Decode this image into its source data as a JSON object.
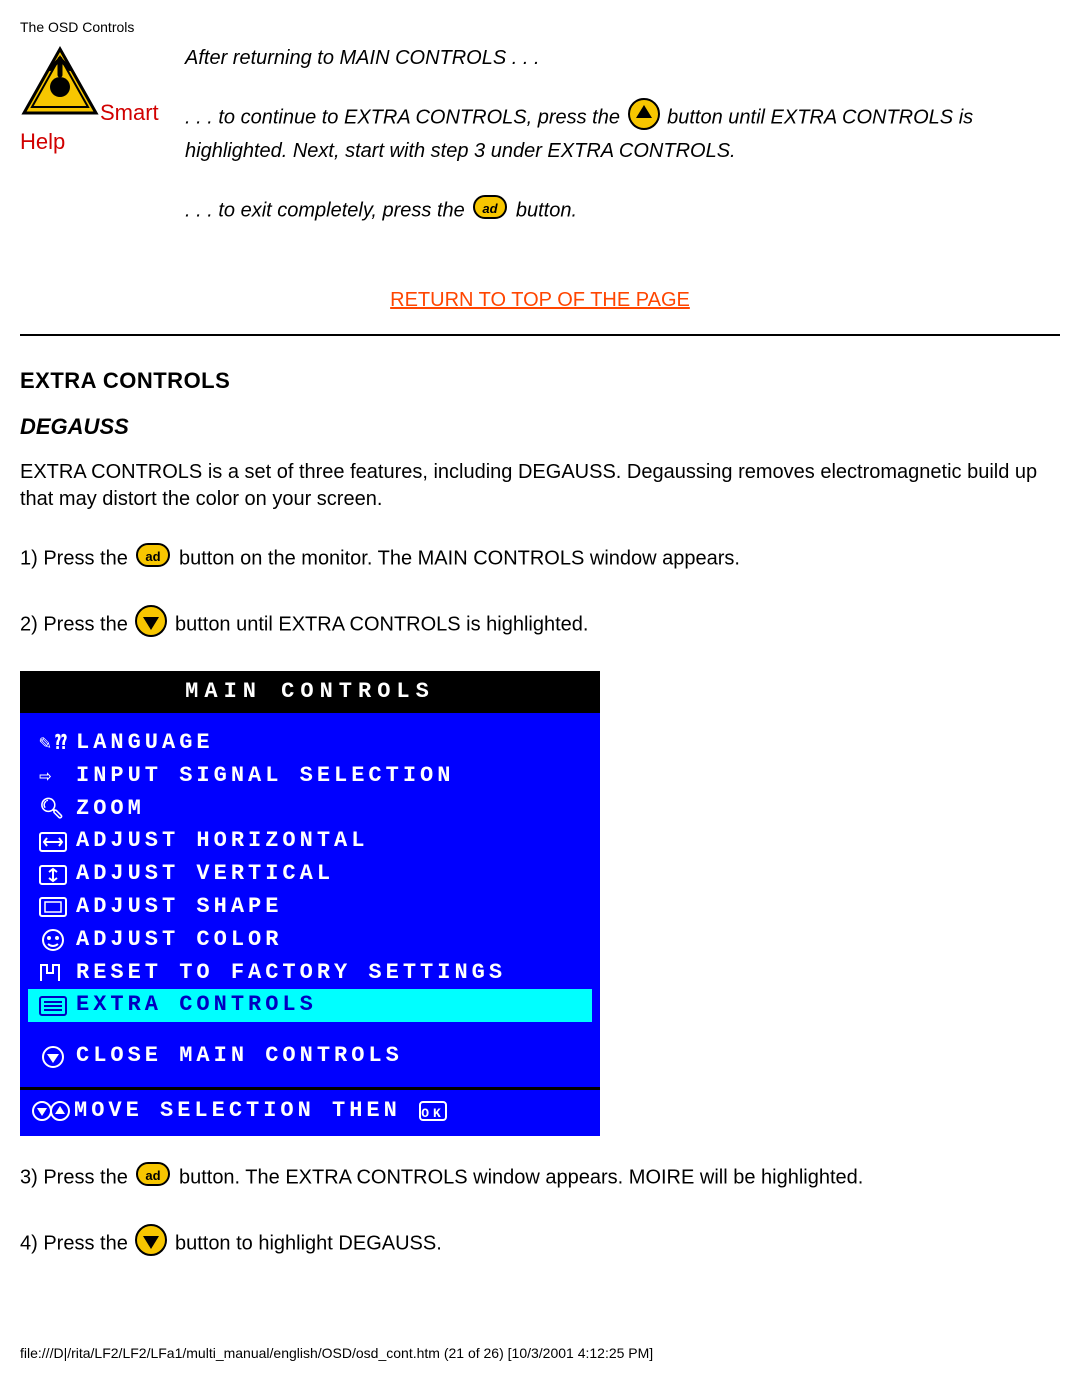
{
  "page_header": "The OSD Controls",
  "smart_help": {
    "smart_label": "Smart",
    "help_label": "Help",
    "line1": "After returning to MAIN CONTROLS . . .",
    "line2a": ". . . to continue to EXTRA CONTROLS, press the ",
    "line2b": " button until EXTRA CONTROLS is highlighted. Next, start with step 3 under EXTRA CONTROLS.",
    "line3a": ". . . to exit completely, press the ",
    "line3b": " button."
  },
  "return_link": "RETURN TO TOP OF THE PAGE",
  "section_title": "EXTRA CONTROLS",
  "subhead": "DEGAUSS",
  "intro": "EXTRA CONTROLS is a set of three features, including DEGAUSS. Degaussing removes electromagnetic build up that may distort the color on your screen.",
  "step1a": "1) Press the ",
  "step1b": " button on the monitor. The MAIN CONTROLS window appears.",
  "step2a": "2) Press the ",
  "step2b": " button until EXTRA CONTROLS is highlighted.",
  "step3a": "3) Press the ",
  "step3b": " button. The EXTRA CONTROLS window appears. MOIRE will be highlighted.",
  "step4a": "4) Press the ",
  "step4b": " button to highlight DEGAUSS.",
  "osd": {
    "title": "MAIN CONTROLS",
    "items": [
      "LANGUAGE",
      "INPUT SIGNAL SELECTION",
      "ZOOM",
      "ADJUST HORIZONTAL",
      "ADJUST VERTICAL",
      "ADJUST SHAPE",
      "ADJUST COLOR",
      "RESET TO FACTORY SETTINGS",
      "EXTRA CONTROLS"
    ],
    "highlight_index": 8,
    "close": "CLOSE MAIN CONTROLS",
    "footer": "MOVE SELECTION THEN"
  },
  "page_footer": "file:///D|/rita/LF2/LF2/LFa1/multi_manual/english/OSD/osd_cont.htm (21 of 26) [10/3/2001 4:12:25 PM]"
}
